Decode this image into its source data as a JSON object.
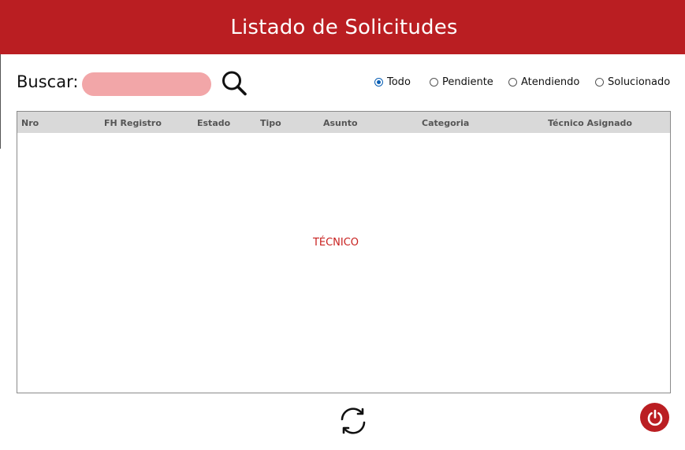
{
  "header": {
    "title": "Listado de Solicitudes",
    "background": "#ba1e22"
  },
  "search": {
    "label": "Buscar:",
    "value": "",
    "placeholder": "",
    "button_icon": "search-icon"
  },
  "filters": {
    "options": [
      {
        "label": "Todo",
        "checked": true
      },
      {
        "label": "Pendiente",
        "checked": false
      },
      {
        "label": "Atendiendo",
        "checked": false
      },
      {
        "label": "Solucionado",
        "checked": false
      }
    ]
  },
  "table": {
    "columns": [
      "Nro",
      "FH Registro",
      "Estado",
      "Tipo",
      "Asunto",
      "Categoria",
      "Técnico Asignado"
    ],
    "rows": [],
    "empty_text": "TÉCNICO"
  },
  "footer": {
    "refresh_icon": "refresh-icon",
    "power_icon": "power-icon",
    "power_color": "#ba1e22"
  }
}
